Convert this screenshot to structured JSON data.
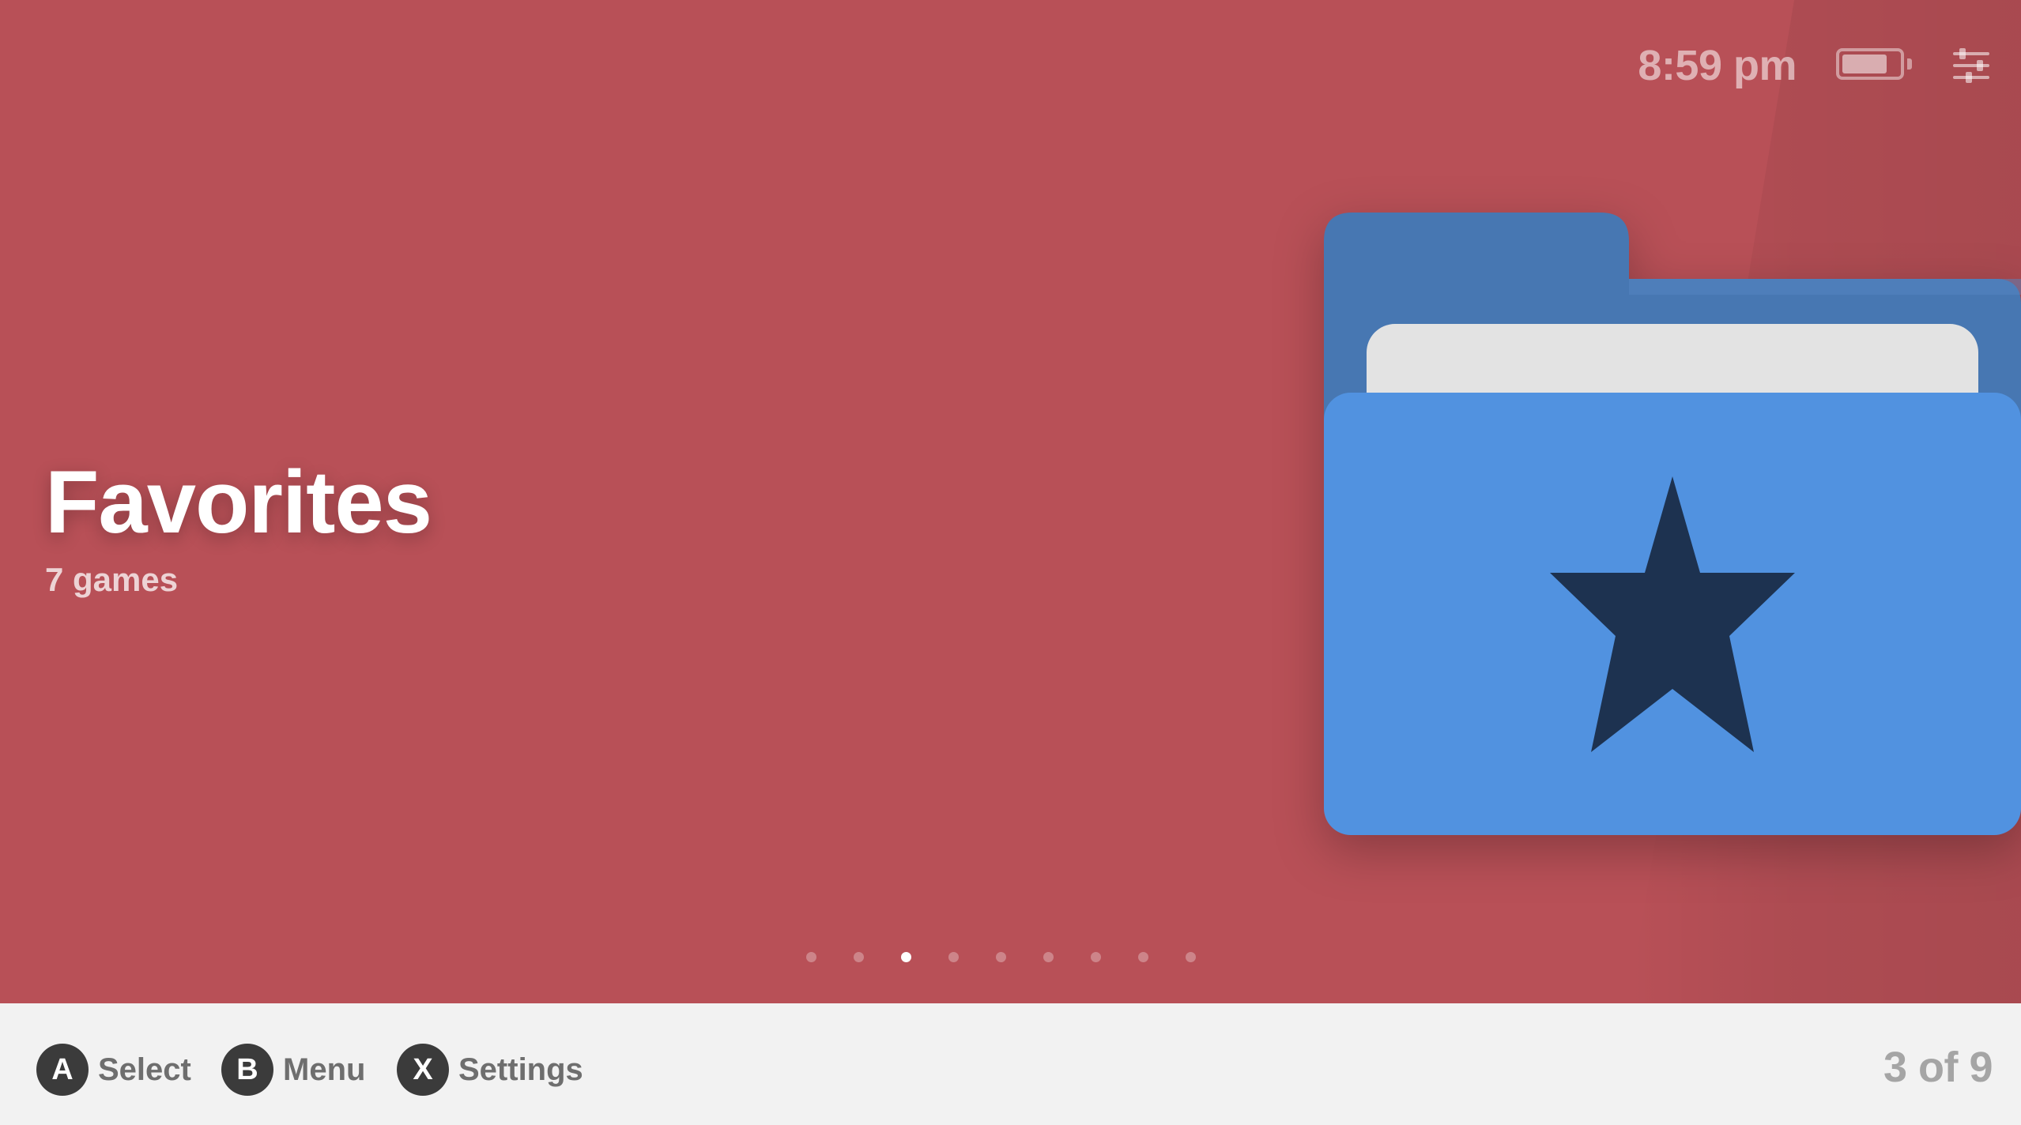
{
  "status_bar": {
    "time": "8:59 pm",
    "battery_level": 0.8,
    "battery_icon": "battery-icon",
    "settings_icon": "sliders-icon"
  },
  "collection": {
    "title": "Favorites",
    "subtitle": "7 games",
    "icon": "star-folder-icon"
  },
  "pager": {
    "total": 9,
    "current": 3
  },
  "footer": {
    "hints": [
      {
        "key": "A",
        "label": "Select"
      },
      {
        "key": "B",
        "label": "Menu"
      },
      {
        "key": "X",
        "label": "Settings"
      }
    ],
    "page_count": "3 of 9"
  },
  "colors": {
    "background": "#b85057",
    "footer": "#f2f2f2",
    "folder_front": "#5192e0",
    "folder_back": "#4777b2",
    "star": "#1d3250",
    "paper": "#e3e3e3"
  }
}
